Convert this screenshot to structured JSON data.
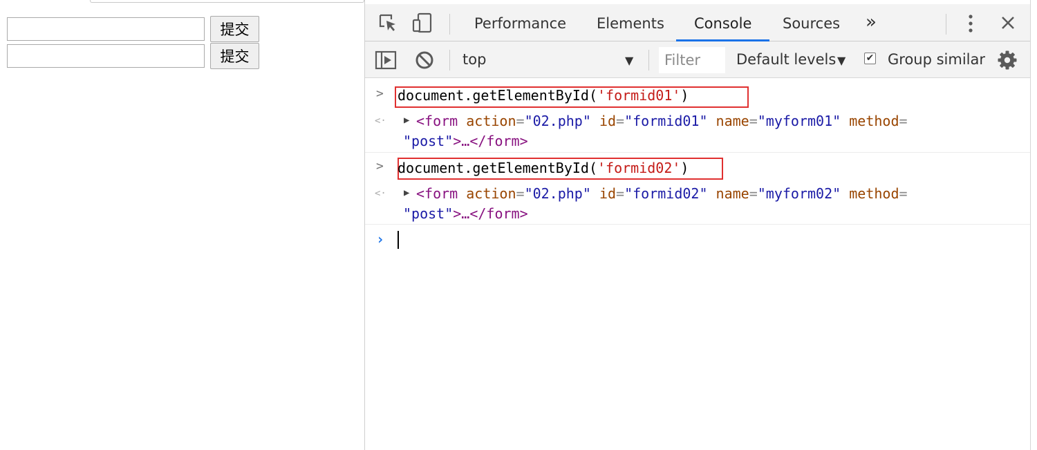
{
  "page": {
    "submit_label": "提交",
    "input1_value": "",
    "input2_value": ""
  },
  "devtools": {
    "tabs": [
      {
        "label": "Performance"
      },
      {
        "label": "Elements"
      },
      {
        "label": "Console",
        "active": true
      },
      {
        "label": "Sources"
      }
    ],
    "more_tabs": "»",
    "toolbar": {
      "context": "top",
      "filter_placeholder": "Filter",
      "levels": "Default levels",
      "group_similar": "Group similar",
      "group_similar_checked": true
    },
    "console": {
      "entries": [
        {
          "cmd_pre": "document.getElementById(",
          "cmd_str": "'formid01'",
          "cmd_post": ")",
          "tag_open": "<form",
          "action_attr": "action",
          "action_val": "\"02.php\"",
          "id_attr": "id",
          "id_val": "\"formid01\"",
          "name_attr": "name",
          "name_val": "\"myform01\"",
          "method_attr": "method",
          "eq": "=",
          "method_val": "\"post\"",
          "tail": ">…</form>"
        },
        {
          "cmd_pre": "document.getElementById(",
          "cmd_str": "'formid02'",
          "cmd_post": ")",
          "tag_open": "<form",
          "action_attr": "action",
          "action_val": "\"02.php\"",
          "id_attr": "id",
          "id_val": "\"formid02\"",
          "name_attr": "name",
          "name_val": "\"myform02\"",
          "method_attr": "method",
          "eq": "=",
          "method_val": "\"post\"",
          "tail": ">…</form>"
        }
      ],
      "input_prompt": "›"
    }
  },
  "colors": {
    "accent": "#1a73e8",
    "highlight_box": "#e03030",
    "tag": "#881280",
    "attr_name": "#994500",
    "attr_value": "#1a1aa6",
    "string": "#c41a16"
  },
  "icons": [
    "inspect-element-icon",
    "device-toolbar-icon",
    "more-tabs-icon",
    "kebab-menu-icon",
    "close-icon",
    "sidebar-toggle-icon",
    "clear-console-icon",
    "dropdown-arrow-icon",
    "checkbox-icon",
    "gear-icon",
    "expand-triangle-icon"
  ]
}
